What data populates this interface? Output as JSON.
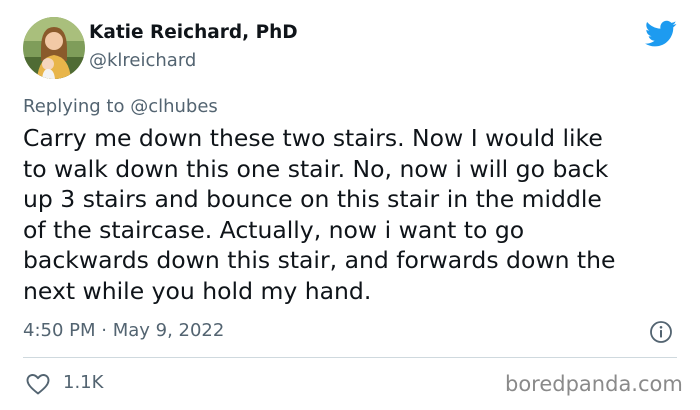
{
  "author": {
    "display_name": "Katie Reichard, PhD",
    "handle": "@klreichard",
    "avatar_icon": "profile-photo"
  },
  "brand": {
    "logo_icon": "twitter-bird-icon",
    "color": "#1d9bf0"
  },
  "reply_context": {
    "prefix": "Replying to ",
    "mention": "@clhubes"
  },
  "tweet": {
    "lines": [
      "Carry me down these two stairs. Now I would like",
      "to walk down this one stair. No, now i will go back",
      "up 3 stairs and bounce on this stair in the middle",
      "of the staircase. Actually, now i want to go",
      "backwards down this stair, and forwards down the",
      "next while you hold my hand."
    ]
  },
  "meta": {
    "timestamp": "4:50 PM · May 9, 2022",
    "info_icon": "info-icon"
  },
  "actions": {
    "like_icon": "heart-icon",
    "like_count": "1.1K"
  },
  "watermark": "boredpanda.com",
  "colors": {
    "text_primary": "#0f1419",
    "text_secondary": "#536471",
    "divider": "#cfd9de"
  }
}
